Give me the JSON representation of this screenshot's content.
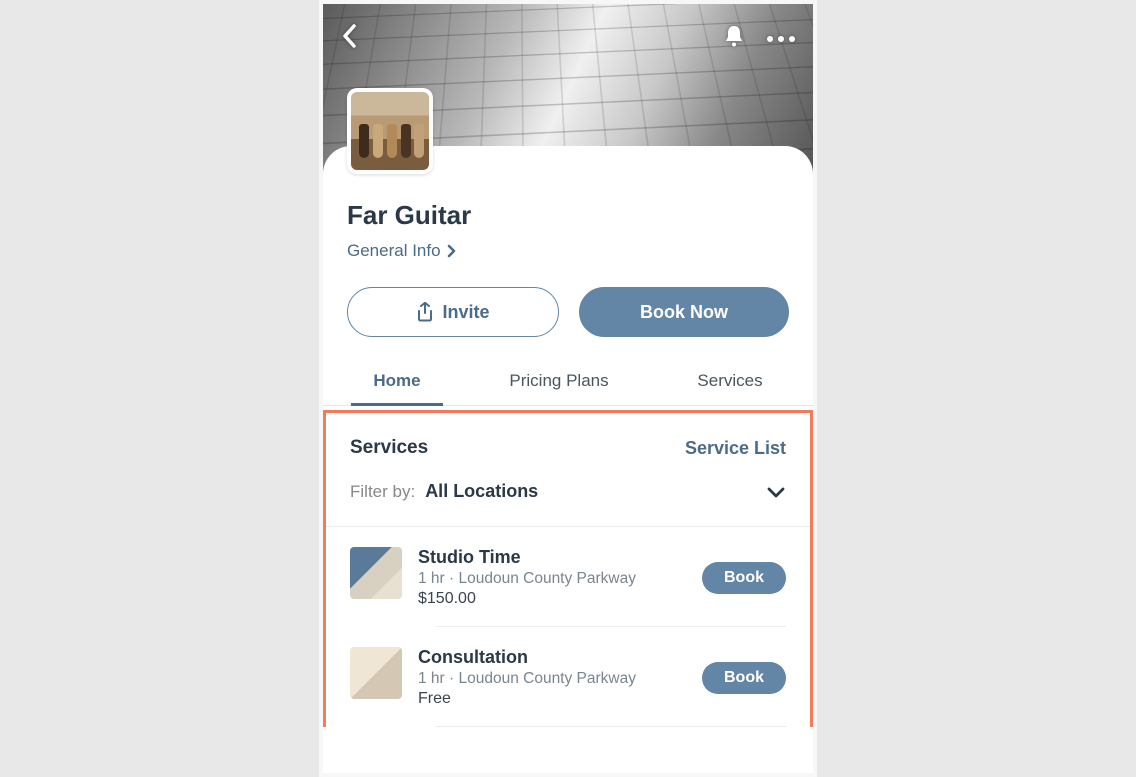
{
  "header": {
    "title": "Far Guitar",
    "general_info_label": "General Info"
  },
  "actions": {
    "invite_label": "Invite",
    "book_now_label": "Book Now"
  },
  "tabs": [
    {
      "label": "Home",
      "active": true
    },
    {
      "label": "Pricing Plans",
      "active": false
    },
    {
      "label": "Services",
      "active": false
    }
  ],
  "services_section": {
    "heading": "Services",
    "list_link": "Service List",
    "filter_label": "Filter by:",
    "filter_value": "All Locations"
  },
  "services": [
    {
      "name": "Studio Time",
      "meta": "1 hr · Loudoun County Parkway",
      "price": "$150.00",
      "book_label": "Book"
    },
    {
      "name": "Consultation",
      "meta": "1 hr · Loudoun County Parkway",
      "price": "Free",
      "book_label": "Book"
    }
  ]
}
